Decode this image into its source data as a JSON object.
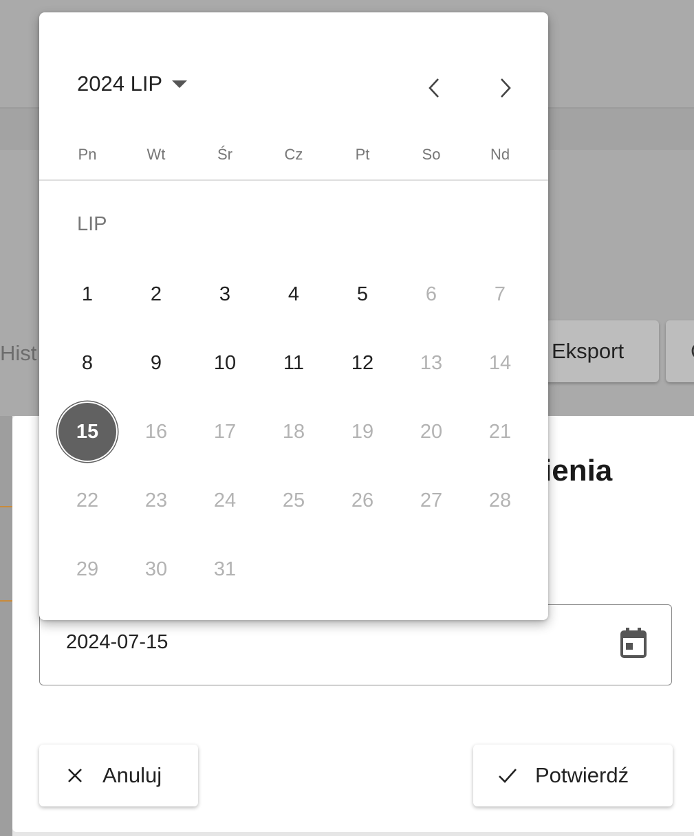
{
  "background": {
    "partial_tab": "Hist",
    "export_button": "Eksport",
    "next_button_partial": "C"
  },
  "dialog": {
    "title_partial": "ienia",
    "date_field": {
      "value": "2024-07-15",
      "icon": "calendar-icon"
    },
    "cancel_button": {
      "label": "Anuluj",
      "icon": "close-icon"
    },
    "confirm_button": {
      "label": "Potwierdź",
      "icon": "check-icon"
    }
  },
  "picker": {
    "header": "2024 LIP",
    "month_label": "LIP",
    "weekdays": [
      "Pn",
      "Wt",
      "Śr",
      "Cz",
      "Pt",
      "So",
      "Nd"
    ],
    "selected_day": "15",
    "weeks": [
      [
        "1",
        "2",
        "3",
        "4",
        "5",
        "6",
        "7"
      ],
      [
        "8",
        "9",
        "10",
        "11",
        "12",
        "13",
        "14"
      ],
      [
        "15",
        "16",
        "17",
        "18",
        "19",
        "20",
        "21"
      ],
      [
        "22",
        "23",
        "24",
        "25",
        "26",
        "27",
        "28"
      ],
      [
        "29",
        "30",
        "31",
        "",
        "",
        "",
        ""
      ]
    ]
  },
  "colors": {
    "selected_day_bg": "#616161",
    "disabled_day": "#b3b3b3",
    "backdrop": "#aaaaaa"
  }
}
